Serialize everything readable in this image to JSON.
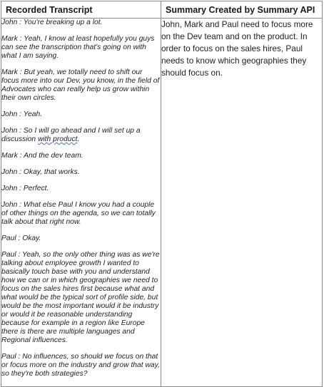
{
  "table": {
    "headers": {
      "left": "Recorded Transcript",
      "right": "Summary Created by Summary API"
    },
    "transcript": [
      "John : You're breaking up a lot.",
      "Mark : Yeah, I know at least hopefully you guys can see the transcription that's going on with what I am saying.",
      "Mark : But yeah, we totally need to shift our focus more into our Dev, you know, in the field of Advocates who can really help us grow within their own circles.",
      "John : Yeah.",
      "Mark : And the dev team.",
      "John : Okay, that works.",
      "John : Perfect.",
      "John : What else Paul I know you had a couple of other things on the agenda, so we can totally talk about that right now.",
      "Paul : Okay.",
      "Paul : Yeah, so the only other thing was as we're talking about employee growth I wanted to basically touch base with you and understand how we can or in which geographies we need to focus on the sales hires first because what and what would be the typical sort of profile side, but would be the most important would it be industry or would it be reasonable understanding because for example in a region like Europe there is there are multiple languages and Regional influences.",
      "Paul : No influences, so should we focus on that or focus more on the industry and grow that way, so they're both strategies?"
    ],
    "setup_line": {
      "before": "John : So I will go ahead and I will set up a discussion ",
      "underlined": "with product",
      "after": "."
    },
    "summary": "John, Mark and Paul need to focus more on the Dev team and on the product. In order to focus on the sales hires, Paul needs to know which geographies they should focus on."
  }
}
